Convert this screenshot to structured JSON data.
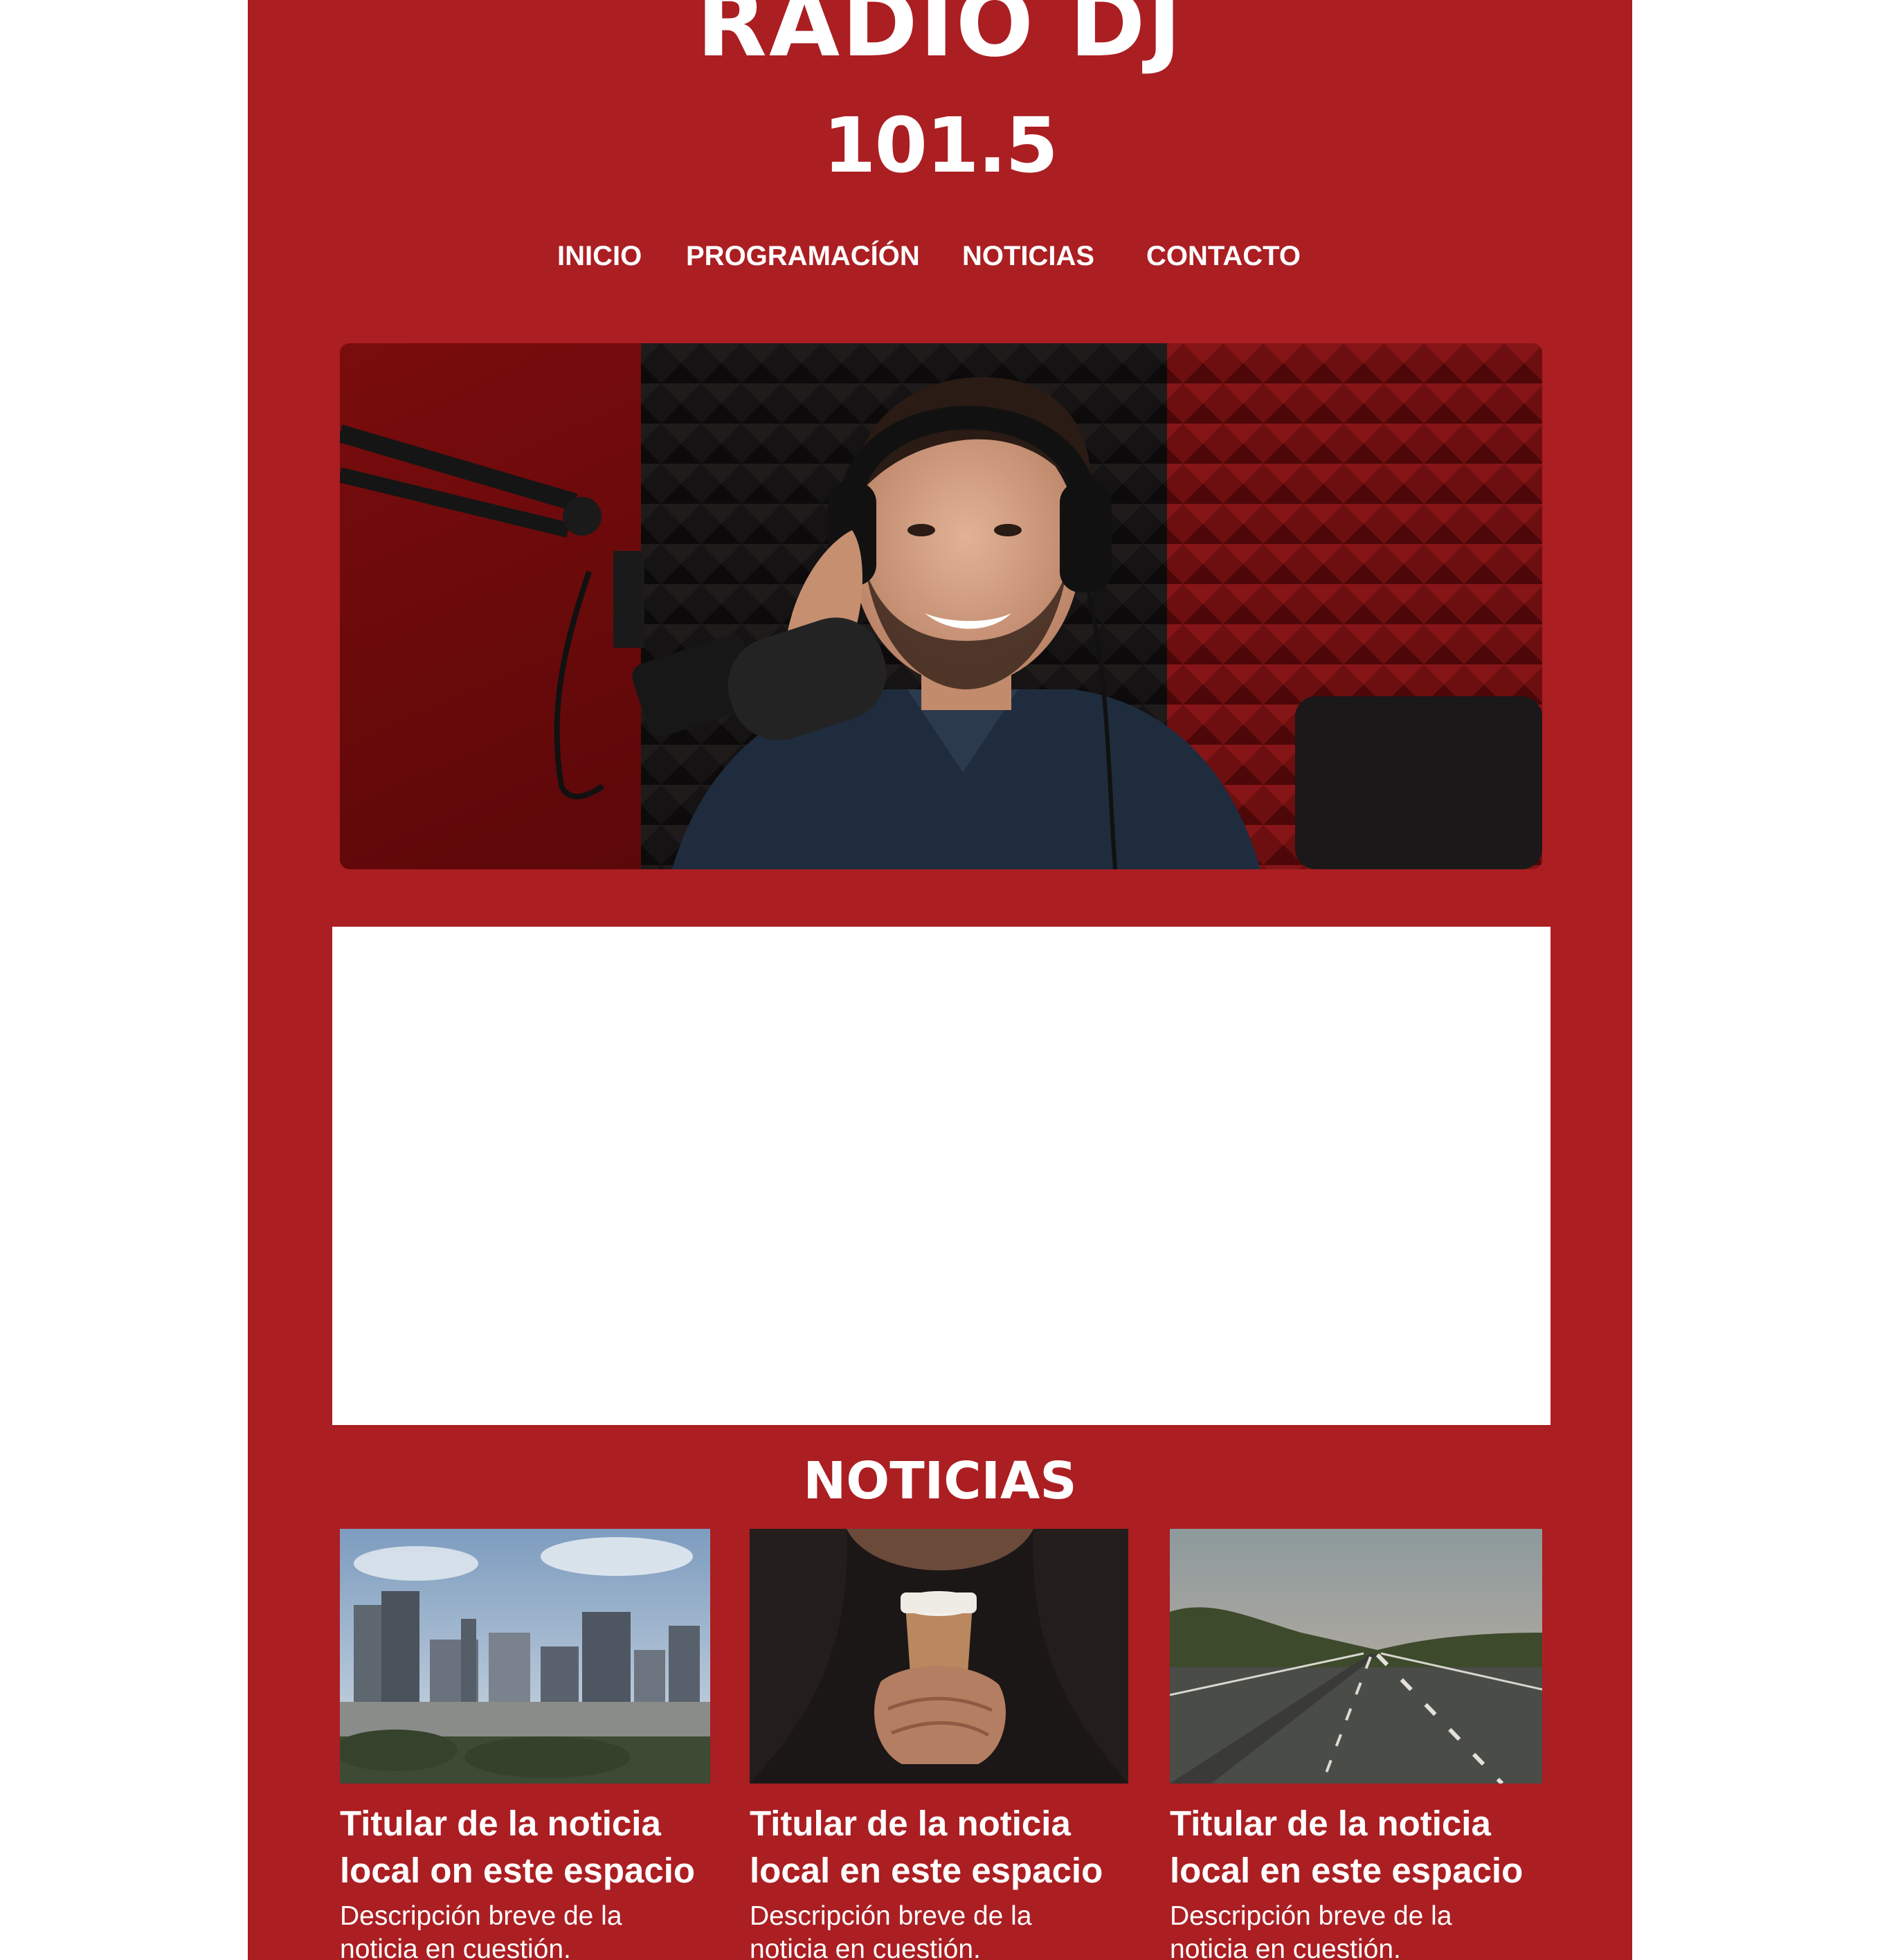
{
  "brand": {
    "name": "RADIO DJ",
    "frequency": "101.5"
  },
  "nav": {
    "items": [
      {
        "label": "INICIO"
      },
      {
        "label": "PROGRAMACÍÓN"
      },
      {
        "label": "NOTICIAS"
      },
      {
        "label": "CONTACTO"
      }
    ]
  },
  "hero": {
    "image": "radio-host-with-headphones-and-microphone"
  },
  "news": {
    "title": "NOTICIAS",
    "items": [
      {
        "image": "city-skyline-photo",
        "headline_line1": "Titular de la noticia",
        "headline_line2": "local on este espacio",
        "desc_line1": "Descripción breve de la",
        "desc_line2": "noticia en cuestión."
      },
      {
        "image": "hands-holding-coffee-cup-photo",
        "headline_line1": "Titular de la noticia",
        "headline_line2": "local en este espacio",
        "desc_line1": "Descripción breve de la",
        "desc_line2": "noticia en cuestión."
      },
      {
        "image": "highway-road-photo",
        "headline_line1": "Titular de la noticia",
        "headline_line2": "local en este espacio",
        "desc_line1": "Descripción breve de la",
        "desc_line2": "noticia en cuestión."
      }
    ]
  },
  "colors": {
    "background": "#ffffff",
    "brand_red": "#ab1e22",
    "text": "#ffffff"
  }
}
